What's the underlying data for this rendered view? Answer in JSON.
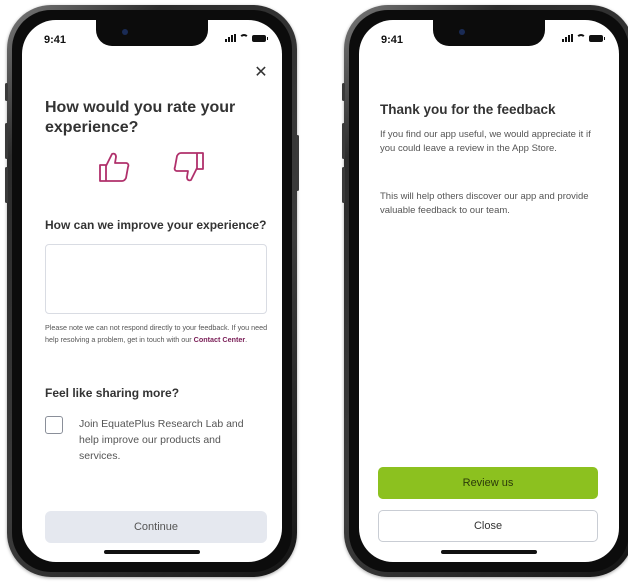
{
  "left_screen": {
    "status_time": "9:41",
    "close_glyph": "✕",
    "title": "How would you rate your experience?",
    "thumbs_up_icon": "thumbs-up-icon",
    "thumbs_down_icon": "thumbs-down-icon",
    "improve_label": "How can we improve your experience?",
    "feedback_value": "",
    "note_text": "Please note we can not respond directly to your feedback. If you need help resolving a problem, get in touch with our ",
    "contact_link": "Contact Center",
    "note_end": ".",
    "sharing_title": "Feel like sharing more?",
    "research_label": "Join EquatePlus Research Lab and help improve our products and services.",
    "continue_label": "Continue"
  },
  "right_screen": {
    "status_time": "9:41",
    "title": "Thank you for the feedback",
    "para1": "If you find our app useful, we would appreciate it if you could leave a review in the App Store.",
    "para2": "This will help others discover our app and provide valuable feedback to our team.",
    "review_label": "Review us",
    "close_label": "Close"
  },
  "colors": {
    "accent_link": "#7a1e57",
    "thumb_icon": "#b0306b",
    "review_button": "#8cc11f",
    "continue_button": "#e5e8ef"
  }
}
